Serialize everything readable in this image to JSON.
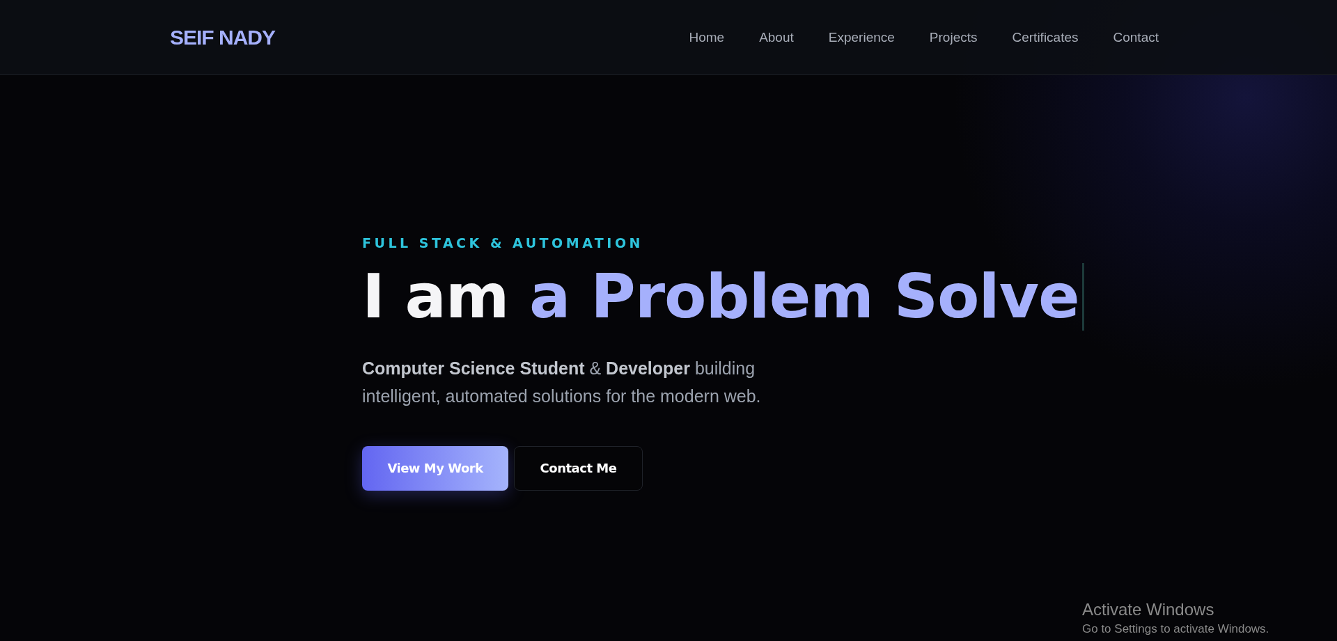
{
  "header": {
    "logo": "SEIF NADY",
    "nav": [
      {
        "label": "Home"
      },
      {
        "label": "About"
      },
      {
        "label": "Experience"
      },
      {
        "label": "Projects"
      },
      {
        "label": "Certificates"
      },
      {
        "label": "Contact"
      }
    ]
  },
  "hero": {
    "eyebrow": "FULL STACK & AUTOMATION",
    "headline_prefix": "I am",
    "headline_highlight": "a Problem Solve",
    "subtitle": "**Computer Science Student** & **Developer** building intelligent, automated solutions for the modern web.",
    "buttons": [
      {
        "label": "View My Work",
        "kind": "primary"
      },
      {
        "label": "Contact Me",
        "kind": "secondary"
      }
    ]
  },
  "activation_notice": {
    "title": "Activate Windows",
    "message": "Go to Settings to activate Windows."
  }
}
